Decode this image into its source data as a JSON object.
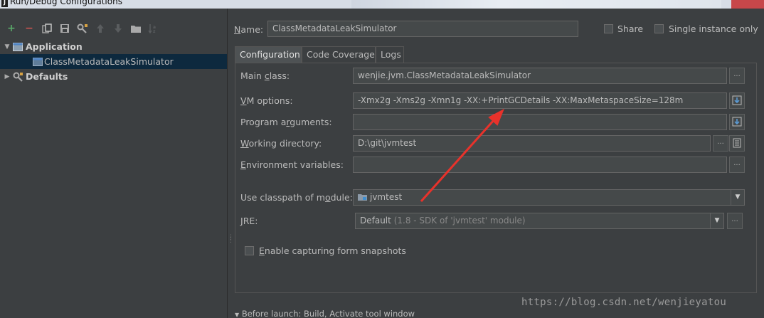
{
  "window": {
    "title": "Run/Debug Configurations"
  },
  "toolbar": {
    "icons": [
      "add-icon",
      "remove-icon",
      "copy-icon",
      "save-icon",
      "wrench-icon",
      "move-up-icon",
      "move-down-icon",
      "folder-icon",
      "sort-icon"
    ]
  },
  "tree": {
    "application": "Application",
    "selected_config": "ClassMetadataLeakSimulator",
    "defaults": "Defaults"
  },
  "name_row": {
    "label": "Name:",
    "value": "ClassMetadataLeakSimulator",
    "share_label": "Share",
    "single_instance_label": "Single instance only"
  },
  "tabs": [
    "Configuration",
    "Code Coverage",
    "Logs"
  ],
  "form": {
    "main_class_label": "Main class:",
    "main_class_value": "wenjie.jvm.ClassMetadataLeakSimulator",
    "vm_options_label": "VM options:",
    "vm_options_value": "-Xmx2g -Xms2g -Xmn1g -XX:+PrintGCDetails -XX:MaxMetaspaceSize=128m",
    "program_args_label": "Program arguments:",
    "program_args_value": "",
    "working_dir_label": "Working directory:",
    "working_dir_value": "D:\\git\\jvmtest",
    "env_vars_label": "Environment variables:",
    "env_vars_value": "",
    "classpath_label": "Use classpath of module:",
    "classpath_value": "jvmtest",
    "jre_label": "JRE:",
    "jre_value": "Default",
    "jre_hint": "(1.8 - SDK of 'jvmtest' module)",
    "snapshots_label": "Enable capturing form snapshots",
    "ellipsis": "..."
  },
  "before_launch": "Before launch: Build, Activate tool window",
  "watermark": "https://blog.csdn.net/wenjieyatou",
  "colors": {
    "annotation_arrow": "#e8322b",
    "selected_row": "#0d293e",
    "add_green": "#59a869",
    "remove_red": "#c75450"
  }
}
